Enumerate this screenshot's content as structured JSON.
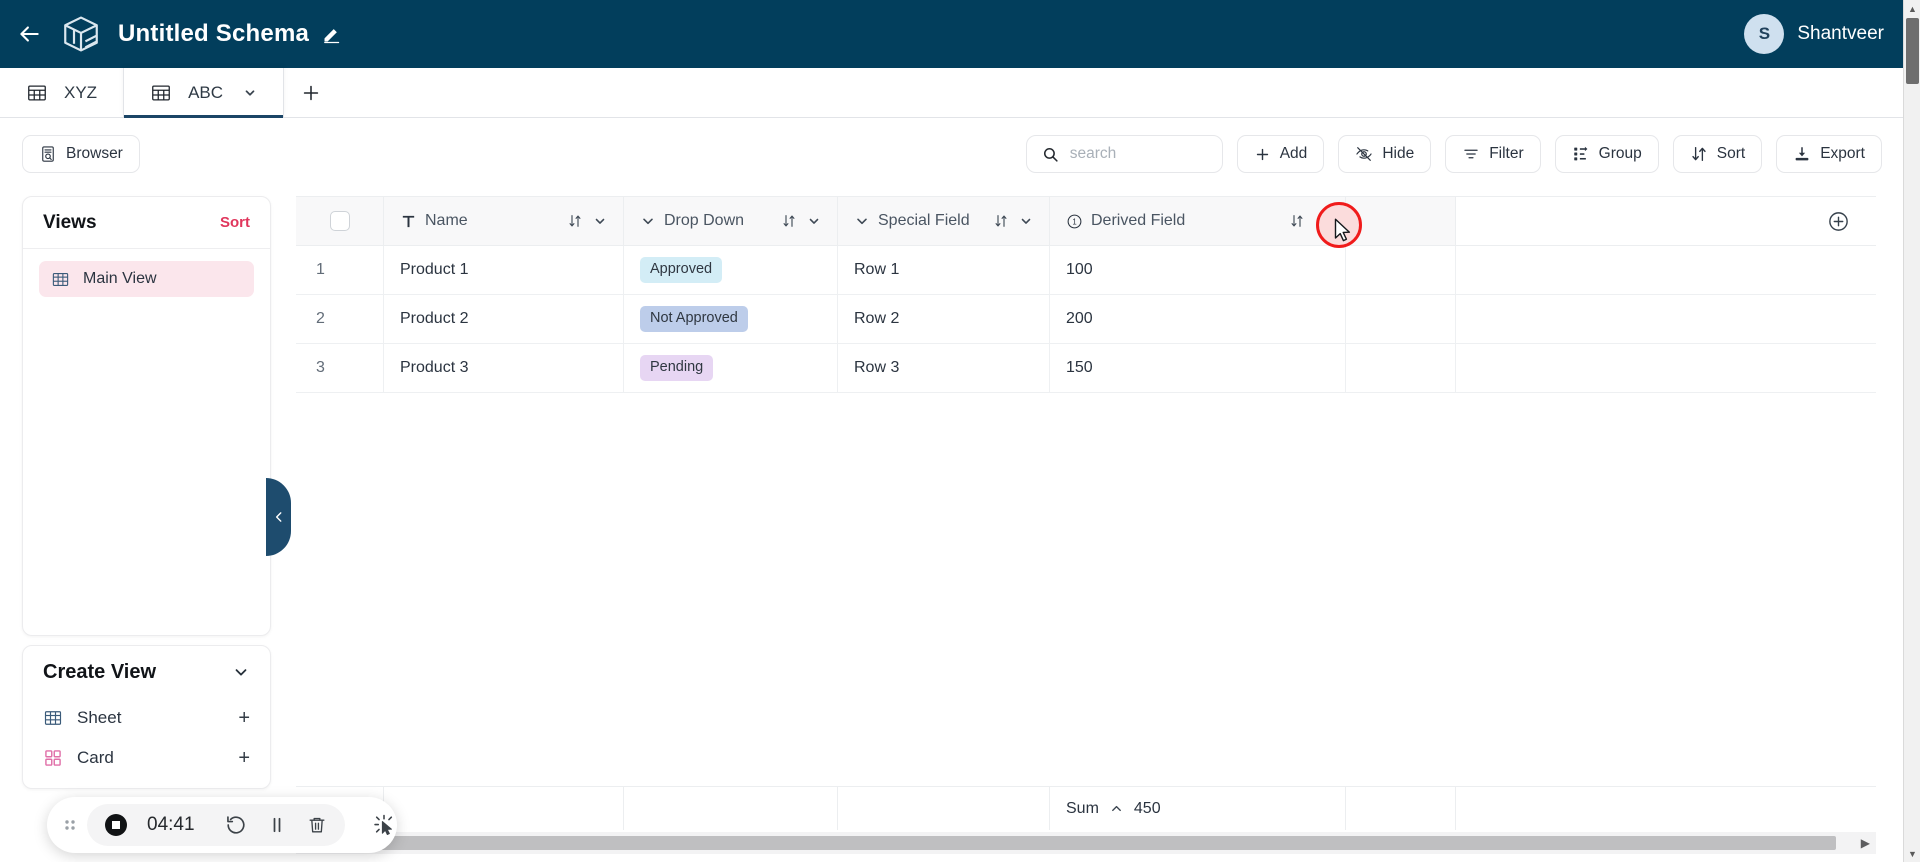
{
  "topbar": {
    "back_icon": "arrow-left-icon",
    "logo_icon": "cube-logo-icon",
    "title": "Untitled Schema",
    "edit_icon": "pencil-icon",
    "user": {
      "initial": "S",
      "name": "Shantveer"
    },
    "bg_color": "#023e5c"
  },
  "tabs": {
    "items": [
      {
        "label": "XYZ",
        "icon": "table-icon",
        "active": false
      },
      {
        "label": "ABC",
        "icon": "table-icon",
        "active": true,
        "chevron": "chevron-down-icon"
      }
    ],
    "add_label": "+"
  },
  "toolbar": {
    "browser_label": "Browser",
    "search": {
      "value": "",
      "placeholder": "search",
      "icon": "search-icon"
    },
    "buttons": [
      {
        "label": "Add",
        "icon": "plus-icon"
      },
      {
        "label": "Hide",
        "icon": "eye-off-icon"
      },
      {
        "label": "Filter",
        "icon": "filter-icon"
      },
      {
        "label": "Group",
        "icon": "group-icon"
      },
      {
        "label": "Sort",
        "icon": "sort-icon"
      },
      {
        "label": "Export",
        "icon": "download-icon"
      }
    ]
  },
  "views_panel": {
    "title": "Views",
    "sort_label": "Sort",
    "sort_color": "#e0365c",
    "items": [
      {
        "label": "Main View",
        "icon": "sheet-icon",
        "selected": true
      }
    ]
  },
  "create_panel": {
    "title": "Create View",
    "chevron": "chevron-down-icon",
    "rows": [
      {
        "label": "Sheet",
        "icon": "sheet-icon",
        "action": "+"
      },
      {
        "label": "Card",
        "icon": "card-icon",
        "action": "+"
      }
    ]
  },
  "collapse_handle": {
    "icon": "chevron-left-icon",
    "color": "#1e4c6e"
  },
  "grid": {
    "columns": [
      {
        "label": "Name",
        "type_icon": "text-type-icon",
        "sort_icon": "sort-arrows-icon",
        "menu_icon": "chevron-down-icon"
      },
      {
        "label": "Drop Down",
        "type_icon": "chevron-down-icon",
        "sort_icon": "sort-arrows-icon",
        "menu_icon": "chevron-down-icon"
      },
      {
        "label": "Special Field",
        "type_icon": "chevron-down-icon",
        "sort_icon": "sort-arrows-icon",
        "menu_icon": "chevron-down-icon"
      },
      {
        "label": "Derived Field",
        "type_icon": "number-type-icon",
        "sort_icon": "sort-arrows-icon",
        "menu_icon": "chevron-down-icon"
      }
    ],
    "add_column_icon": "plus-circle-icon",
    "rows": [
      {
        "index": "1",
        "name": "Product 1",
        "drop_down": "Approved",
        "drop_down_color": "#d3edf6",
        "special_field": "Row 1",
        "derived_field": "100"
      },
      {
        "index": "2",
        "name": "Product 2",
        "drop_down": "Not Approved",
        "drop_down_color": "#bdcdea",
        "special_field": "Row 2",
        "derived_field": "200"
      },
      {
        "index": "3",
        "name": "Product 3",
        "drop_down": "Pending",
        "drop_down_color": "#e7d6f3",
        "special_field": "Row 3",
        "derived_field": "150"
      }
    ],
    "footer": {
      "agg_label": "Sum",
      "agg_chevron": "chevron-up-icon",
      "agg_value": "450"
    }
  },
  "click_highlight": {
    "ring_color": "#f01b1b",
    "fill_color": "#fbdcdc",
    "cursor_icon": "mouse-pointer-icon"
  },
  "recorder": {
    "drag_icon": "drag-dots-icon",
    "stop_icon": "stop-record-icon",
    "time": "04:41",
    "restart_icon": "restart-icon",
    "pause_icon": "pause-icon",
    "delete_icon": "trash-icon",
    "cursor_icon": "click-highlight-icon"
  },
  "scrollbars": {
    "vertical": {
      "up_icon": "caret-up-icon",
      "down_icon": "caret-down-icon"
    },
    "horizontal": {
      "right_icon": "caret-right-icon"
    }
  }
}
